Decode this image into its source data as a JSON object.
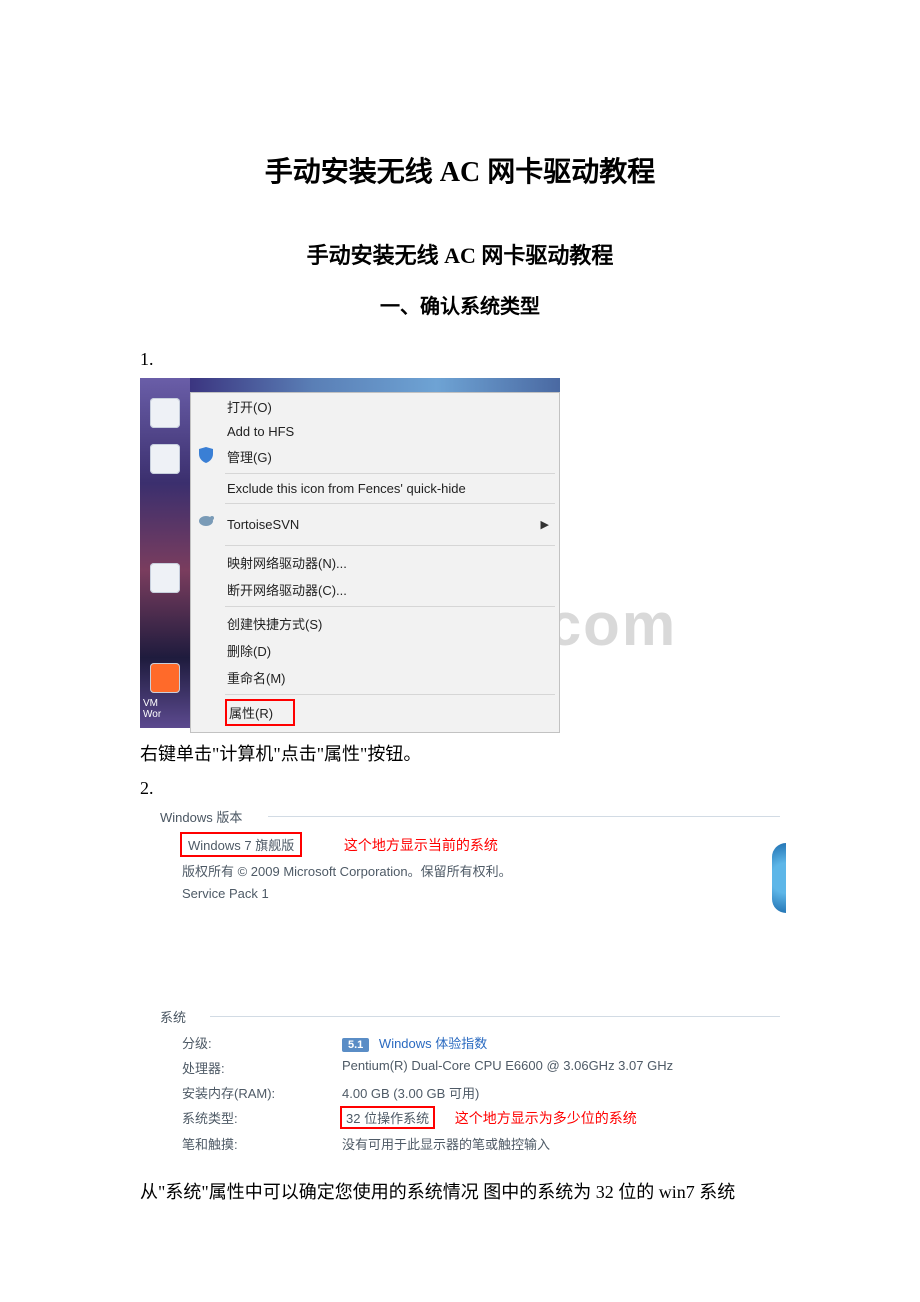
{
  "doc": {
    "main_title": "手动安装无线 AC 网卡驱动教程",
    "sub_title": "手动安装无线 AC 网卡驱动教程",
    "section1_title": "一、确认系统类型",
    "step1_num": "1.",
    "step1_text": "右键单击\"计算机\"点击\"属性\"按钮。",
    "step2_num": "2.",
    "conclusion": "从\"系统\"属性中可以确定您使用的系统情况 图中的系统为 32 位的 win7 系统"
  },
  "watermark": "www.bdocx.com",
  "context_menu": {
    "items": {
      "open": "打开(O)",
      "add_hfs": "Add to HFS",
      "manage": "管理(G)",
      "exclude_fences": "Exclude this icon from Fences' quick-hide",
      "tortoise_svn": "TortoiseSVN",
      "map_drive": "映射网络驱动器(N)...",
      "disconnect_drive": "断开网络驱动器(C)...",
      "shortcut": "创建快捷方式(S)",
      "delete": "删除(D)",
      "rename": "重命名(M)",
      "properties": "属性(R)"
    },
    "desktop_label": "VM\nWor"
  },
  "sysprops": {
    "edition_header": "Windows 版本",
    "edition_name": "Windows 7 旗舰版",
    "edition_note": "这个地方显示当前的系统",
    "copyright": "版权所有 © 2009 Microsoft Corporation。保留所有权利。",
    "sp": "Service Pack 1",
    "system_header": "系统",
    "rows": {
      "rating_label": "分级:",
      "rating_badge": "5.1",
      "rating_link": "Windows 体验指数",
      "cpu_label": "处理器:",
      "cpu_value": "Pentium(R) Dual-Core  CPU       E6600  @ 3.06GHz   3.07 GHz",
      "ram_label": "安装内存(RAM):",
      "ram_value": "4.00 GB (3.00 GB 可用)",
      "type_label": "系统类型:",
      "type_value": "32 位操作系统",
      "type_note": "这个地方显示为多少位的系统",
      "pen_label": "笔和触摸:",
      "pen_value": "没有可用于此显示器的笔或触控输入"
    }
  }
}
